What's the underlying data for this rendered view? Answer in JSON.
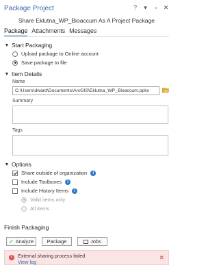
{
  "window": {
    "title": "Package Project",
    "controls": [
      "?",
      "▾",
      "▫",
      "✕"
    ]
  },
  "subtitle": "Share Eklutna_WP_Bioaccum As A Project Package",
  "tabs": [
    {
      "label": "Package",
      "active": true
    },
    {
      "label": "Attachments",
      "active": false
    },
    {
      "label": "Messages",
      "active": false
    }
  ],
  "start_packaging": {
    "heading": "Start Packaging",
    "options": [
      {
        "label": "Upload package to Online account",
        "selected": false
      },
      {
        "label": "Save package to file",
        "selected": true
      }
    ]
  },
  "item_details": {
    "heading": "Item Details",
    "name_label": "Name",
    "name_value": "C:\\Users\\dward\\Documents\\ArcGIS\\Eklutna_WP_Bioaccum.ppkx",
    "summary_label": "Summary",
    "summary_value": "",
    "tags_label": "Tags",
    "tags_value": ""
  },
  "options": {
    "heading": "Options",
    "share_outside": {
      "label": "Share outside of organization",
      "checked": true
    },
    "include_toolboxes": {
      "label": "Include Toolboxes",
      "checked": false
    },
    "include_history": {
      "label": "Include History Items",
      "checked": false
    },
    "history_options": [
      {
        "label": "Valid items only",
        "selected": true
      },
      {
        "label": "All items",
        "selected": false
      }
    ]
  },
  "finish": {
    "heading": "Finish Packaging",
    "analyze_label": "Analyze",
    "package_label": "Package",
    "jobs_label": "Jobs"
  },
  "error": {
    "message": "External sharing process failed",
    "link": "View log"
  },
  "colors": {
    "accent": "#2b6cb0",
    "title": "#3b6aa8",
    "info": "#2a79c6",
    "error_bg": "#fbe4e4",
    "error_icon": "#d9534f"
  }
}
